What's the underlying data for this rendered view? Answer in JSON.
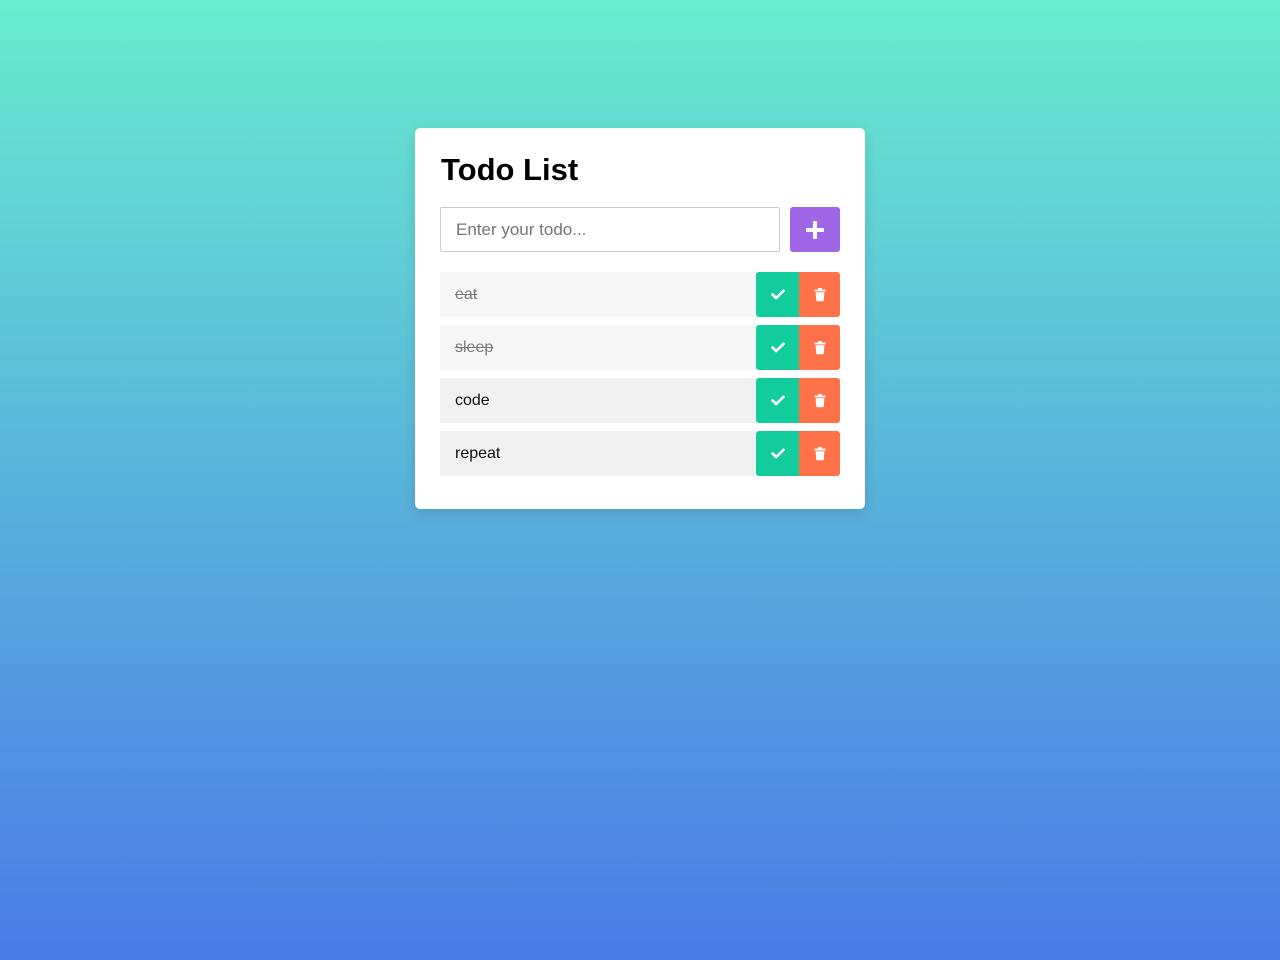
{
  "app": {
    "title": "Todo List"
  },
  "input": {
    "placeholder": "Enter your todo...",
    "value": ""
  },
  "add_button": {
    "icon": "plus-icon"
  },
  "colors": {
    "accent_add": "#a066e8",
    "complete": "#13cc9e",
    "delete": "#ff7148"
  },
  "todos": [
    {
      "text": "eat",
      "completed": true
    },
    {
      "text": "sleep",
      "completed": true
    },
    {
      "text": "code",
      "completed": false
    },
    {
      "text": "repeat",
      "completed": false
    }
  ],
  "item_actions": {
    "complete_icon": "check-icon",
    "delete_icon": "trash-icon"
  }
}
